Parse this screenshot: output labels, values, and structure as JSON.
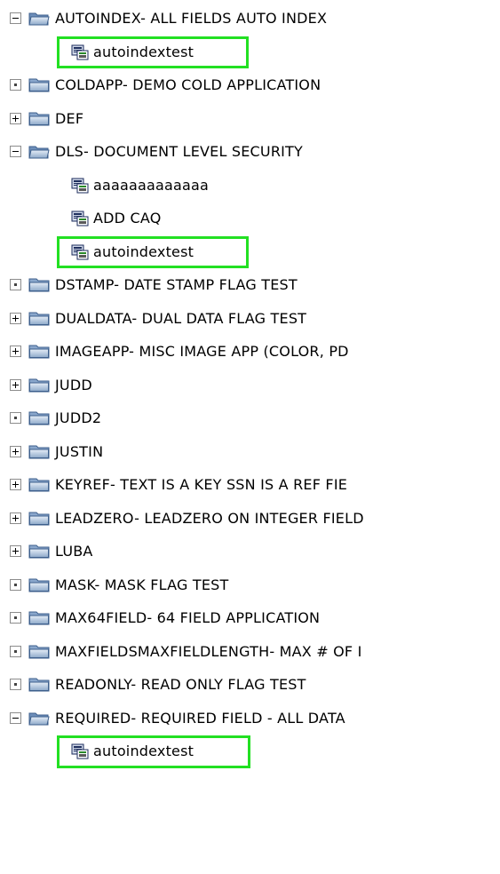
{
  "tree": [
    {
      "type": "folder",
      "toggle": "minus",
      "label": "AUTOINDEX- ALL FIELDS AUTO INDEX",
      "open": true
    },
    {
      "type": "leaf",
      "label": "autoindextest",
      "selected": true
    },
    {
      "type": "folder",
      "toggle": "dot",
      "label": "COLDAPP- DEMO COLD APPLICATION"
    },
    {
      "type": "folder",
      "toggle": "plus",
      "label": "DEF"
    },
    {
      "type": "folder",
      "toggle": "minus",
      "label": "DLS- DOCUMENT LEVEL SECURITY",
      "open": true
    },
    {
      "type": "leaf",
      "label": "aaaaaaaaaaaaa",
      "selected": false
    },
    {
      "type": "leaf",
      "label": "ADD CAQ",
      "selected": false
    },
    {
      "type": "leaf",
      "label": "autoindextest",
      "selected": true
    },
    {
      "type": "folder",
      "toggle": "dot",
      "label": "DSTAMP- DATE STAMP FLAG TEST"
    },
    {
      "type": "folder",
      "toggle": "plus",
      "label": "DUALDATA- DUAL DATA FLAG TEST"
    },
    {
      "type": "folder",
      "toggle": "plus",
      "label": "IMAGEAPP- MISC IMAGE APP (COLOR, PD"
    },
    {
      "type": "folder",
      "toggle": "plus",
      "label": "JUDD"
    },
    {
      "type": "folder",
      "toggle": "dot",
      "label": "JUDD2"
    },
    {
      "type": "folder",
      "toggle": "plus",
      "label": "JUSTIN"
    },
    {
      "type": "folder",
      "toggle": "plus",
      "label": "KEYREF- TEXT IS A KEY SSN IS A REF FIE"
    },
    {
      "type": "folder",
      "toggle": "plus",
      "label": "LEADZERO- LEADZERO ON INTEGER FIELD"
    },
    {
      "type": "folder",
      "toggle": "plus",
      "label": "LUBA"
    },
    {
      "type": "folder",
      "toggle": "dot",
      "label": "MASK- MASK FLAG TEST"
    },
    {
      "type": "folder",
      "toggle": "dot",
      "label": "MAX64FIELD- 64 FIELD APPLICATION"
    },
    {
      "type": "folder",
      "toggle": "dot",
      "label": "MAXFIELDSMAXFIELDLENGTH- MAX # OF I"
    },
    {
      "type": "folder",
      "toggle": "dot",
      "label": "READONLY- READ ONLY FLAG TEST"
    },
    {
      "type": "folder",
      "toggle": "minus",
      "label": "REQUIRED- REQUIRED FIELD - ALL DATA",
      "open": true
    },
    {
      "type": "leaf",
      "label": "autoindextest",
      "selected": true
    }
  ],
  "colors": {
    "selection_border": "#22e022",
    "folder_fill": "#7fa2cc"
  },
  "icons": {
    "folder": "folder-icon",
    "leaf": "document-index-icon"
  }
}
